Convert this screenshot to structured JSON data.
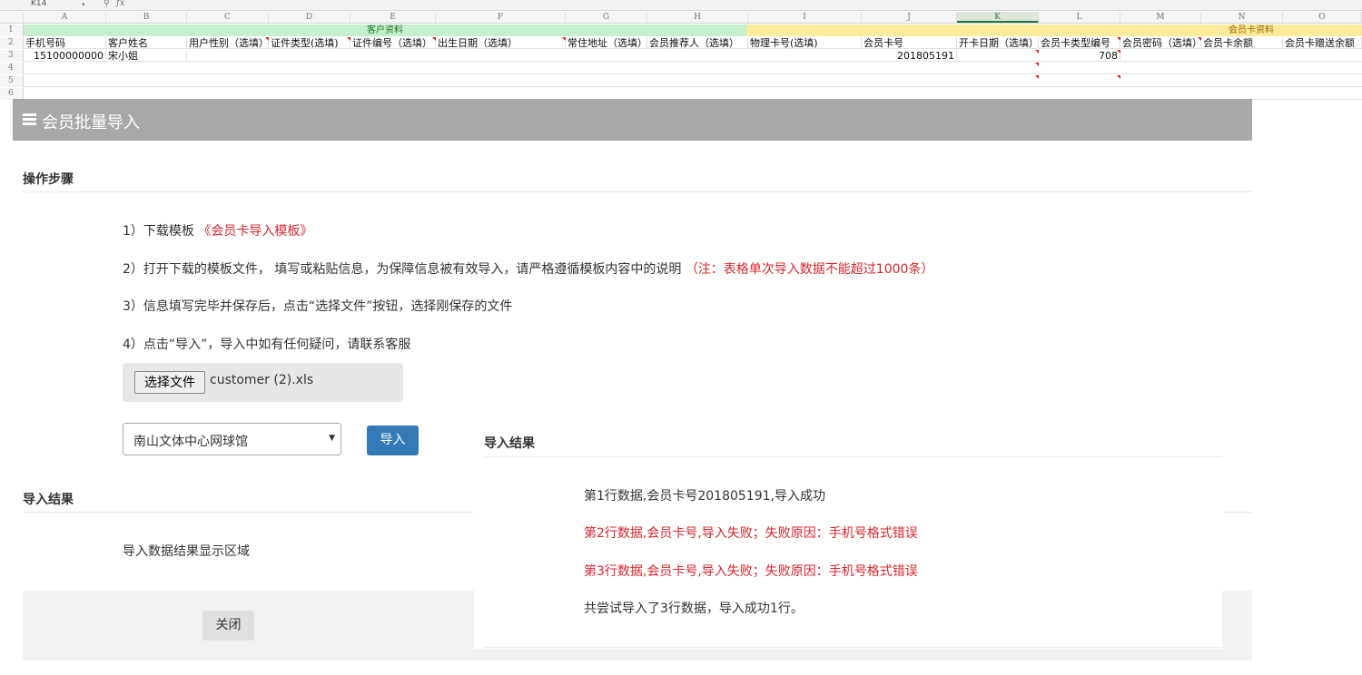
{
  "spreadsheet": {
    "namebox": "K14",
    "fx": "fx",
    "columns": [
      "A",
      "B",
      "C",
      "D",
      "E",
      "F",
      "G",
      "H",
      "I",
      "J",
      "K",
      "L",
      "M",
      "N",
      "O"
    ],
    "selected_column": "K",
    "row_numbers": [
      "1",
      "2",
      "3",
      "4",
      "5",
      "6"
    ],
    "group_headers": {
      "customer": "客户资料",
      "card": "会员卡资料"
    },
    "header_row": [
      "手机号码",
      "客户姓名",
      "用户性别（选填）",
      "证件类型(选填)",
      "证件编号（选填）",
      "出生日期（选填）",
      "常住地址（选填）",
      "会员推荐人（选填）",
      "物理卡号(选填)",
      "会员卡号",
      "开卡日期（选填）",
      "会员卡类型编号",
      "会员密码（选填）",
      "会员卡余额",
      "会员卡赠送余额"
    ],
    "data_row": {
      "phone": "15100000000",
      "name": "宋小姐",
      "card_no": "201805191",
      "card_type": "708"
    },
    "colors": {
      "green_band": "#c6efce",
      "yellow_band": "#ffeb9c",
      "green_text": "#1a7a2a",
      "yellow_text": "#9c6500"
    }
  },
  "modal": {
    "title": "会员批量导入",
    "steps_title": "操作步骤",
    "step1_prefix": "1）下载模板",
    "step1_link": "《会员卡导入模板》",
    "step2_text": "2）打开下载的模板文件， 填写或粘贴信息，为保障信息被有效导入，请严格遵循模板内容中的说明",
    "step2_note": "（注：表格单次导入数据不能超过1000条）",
    "step3_text": "3）信息填写完毕并保存后，点击“选择文件”按钮，选择刚保存的文件",
    "step4_text": "4）点击“导入”，导入中如有任何疑问，请联系客服",
    "file_button": "选择文件",
    "file_name": "customer (2).xls",
    "select_value": "南山文体中心网球馆",
    "import_button": "导入",
    "result_title": "导入结果",
    "result_placeholder": "导入数据结果显示区域",
    "close_button": "关闭",
    "colors": {
      "header_bg": "#a8a8a8",
      "primary": "#337ab7",
      "error": "#d9262c"
    }
  },
  "results_panel": {
    "title": "导入结果",
    "lines": [
      {
        "text": "第1行数据,会员卡号201805191,导入成功",
        "status": "success"
      },
      {
        "text": "第2行数据,会员卡号,导入失败；失败原因：手机号格式错误",
        "status": "error"
      },
      {
        "text": "第3行数据,会员卡号,导入失败；失败原因：手机号格式错误",
        "status": "error"
      },
      {
        "text": "共尝试导入了3行数据，导入成功1行。",
        "status": "summary"
      }
    ]
  }
}
